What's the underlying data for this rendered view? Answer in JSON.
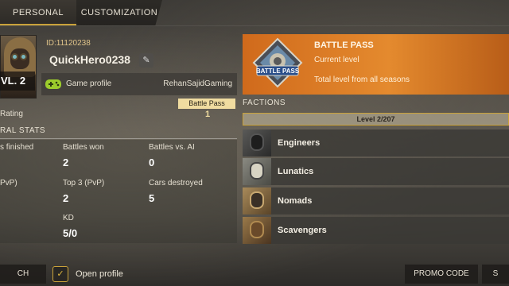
{
  "tabs": [
    {
      "label": "PERSONAL"
    },
    {
      "label": "CUSTOMIZATION"
    }
  ],
  "profile": {
    "level": "VL. 2",
    "id": "ID:11120238",
    "name": "QuickHero0238",
    "edit_icon": "pencil-icon",
    "game_profile_label": "Game profile",
    "game_profile_account": "RehanSajidGaming",
    "gamepad_icon_color": "#9ccc2c"
  },
  "rating": {
    "label": "Rating",
    "badge": "Battle Pass",
    "value": "1"
  },
  "stats": {
    "header": "RAL STATS",
    "cells": [
      {
        "label": "s finished",
        "value": ""
      },
      {
        "label": "Battles won",
        "value": "2"
      },
      {
        "label": "Battles vs. AI",
        "value": "0"
      },
      {
        "label": "PvP)",
        "value": ""
      },
      {
        "label": "Top 3 (PvP)",
        "value": "2"
      },
      {
        "label": "Cars destroyed",
        "value": "5"
      },
      {
        "label": "KD",
        "value": "5/0"
      }
    ]
  },
  "bottom": {
    "watch_label": "CH PROFILE",
    "open_profile_label": "Open profile",
    "promo_label": "PROMO CODE",
    "edge_label": "S"
  },
  "battle_pass": {
    "title": "BATTLE PASS",
    "current_level": "Current level",
    "total_level": "Total level from all seasons",
    "logo_text": "BATTLE PASS"
  },
  "factions": {
    "title": "FACTIONS",
    "level": "Level 2/207",
    "items": [
      {
        "name": "Engineers",
        "color": "#2a2a2a"
      },
      {
        "name": "Lunatics",
        "color": "#6a6a62"
      },
      {
        "name": "Nomads",
        "color": "#8a6a3e"
      },
      {
        "name": "Scavengers",
        "color": "#7a5a3a"
      }
    ]
  },
  "colors": {
    "accent": "#c9a23a",
    "banner": "#e48a2e"
  }
}
